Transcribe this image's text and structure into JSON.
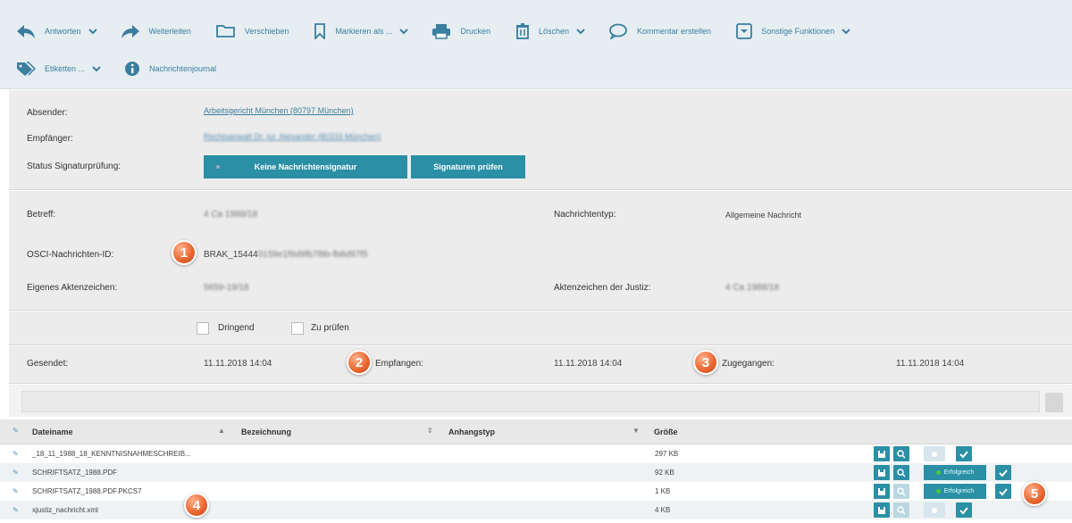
{
  "toolbar": {
    "row1": [
      {
        "icon": "reply-icon",
        "label": "Antworten",
        "dropdown": true
      },
      {
        "icon": "forward-icon",
        "label": "Weiterleiten",
        "dropdown": false
      },
      {
        "icon": "folder-icon",
        "label": "Verschieben",
        "dropdown": false
      },
      {
        "icon": "bookmark-icon",
        "label": "Markieren als ...",
        "dropdown": true
      },
      {
        "icon": "printer-icon",
        "label": "Drucken",
        "dropdown": false
      },
      {
        "icon": "trash-icon",
        "label": "Löschen",
        "dropdown": true
      },
      {
        "icon": "comment-icon",
        "label": "Kommentar erstellen",
        "dropdown": false
      },
      {
        "icon": "more-functions-icon",
        "label": "Sonstige Funktionen",
        "dropdown": true
      }
    ],
    "row2": [
      {
        "icon": "tags-icon",
        "label": "Etiketten ...",
        "dropdown": true
      },
      {
        "icon": "info-icon",
        "label": "Nachrichtenjournal",
        "dropdown": false
      }
    ]
  },
  "header": {
    "sender_label": "Absender:",
    "sender_value": "Arbeitsgericht München (80797 München)",
    "recipient_label": "Empfänger:",
    "recipient_value": "Rechtsanwalt Dr. jur. Alexander (80333 München)",
    "signature_label": "Status Signaturprüfung:",
    "signature_status": "Keine Nachrichtensignatur",
    "check_signatures": "Signaturen prüfen"
  },
  "details": {
    "subject_label": "Betreff:",
    "subject_value": "4 Ca 1988/18",
    "message_type_label": "Nachrichtentyp:",
    "message_type_value": "Allgemeine Nachricht",
    "osci_label": "OSCI-Nachrichten-ID:",
    "osci_value_prefix": "BRAK_15444",
    "osci_value_rest": "0159e1f9d9fb7f8b-fb8d97f5",
    "own_ref_label": "Eigenes Aktenzeichen:",
    "own_ref_value": "5659-19/18",
    "court_ref_label": "Aktenzeichen der Justiz:",
    "court_ref_value": "4 Ca 1988/18"
  },
  "flags": {
    "urgent": "Dringend",
    "to_check": "Zu prüfen"
  },
  "dates": {
    "sent_label": "Gesendet:",
    "sent_value": "11.11.2018 14:04",
    "received_label": "Empfangen:",
    "received_value": "11.11.2018 14:04",
    "delivered_label": "Zugegangen:",
    "delivered_value": "11.11.2018 14:04"
  },
  "markers": [
    "1",
    "2",
    "3",
    "4",
    "5"
  ],
  "table": {
    "headers": {
      "filename": "Dateiname",
      "description": "Bezeichnung",
      "attachment_type": "Anhangstyp",
      "size": "Größe"
    },
    "rows": [
      {
        "name": "_18_11_1988_18_KENNTNISNAHMESCHREIB...",
        "size": "297 KB",
        "status": ""
      },
      {
        "name": "SCHRIFTSATZ_1988.PDF",
        "size": "92 KB",
        "status": "Erfolgreich"
      },
      {
        "name": "SCHRIFTSATZ_1988.PDF.PKCS7",
        "size": "1 KB",
        "status": "Erfolgreich"
      },
      {
        "name": "xjustiz_nachricht.xml",
        "size": "4 KB",
        "status": ""
      }
    ]
  },
  "colors": {
    "accent": "#2b8fa5",
    "link": "#3a7ea0",
    "marker": "#e8642e"
  }
}
